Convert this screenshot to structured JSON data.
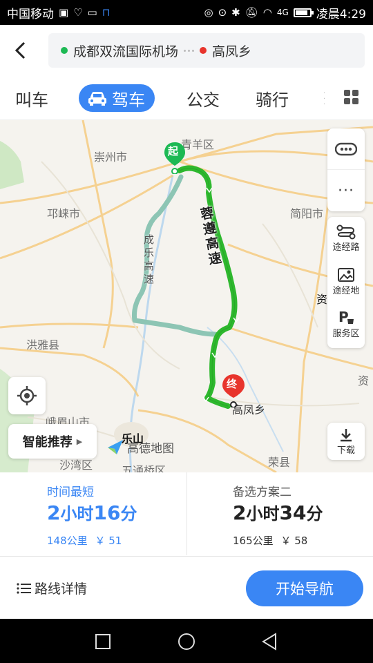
{
  "status": {
    "carrier": "中国移动",
    "network": "4G",
    "time": "凌晨4:29",
    "battery_level": 0.85
  },
  "route": {
    "origin": "成都双流国际机场",
    "destination": "高凤乡",
    "origin_color": "#1db954",
    "destination_color": "#e8342c"
  },
  "modes": [
    {
      "label": "叫车"
    },
    {
      "label": "驾车"
    },
    {
      "label": "公交"
    },
    {
      "label": "骑行"
    }
  ],
  "map": {
    "places": {
      "qingyang": "青羊区",
      "chongzhou": "崇州市",
      "qionglai": "邛崃市",
      "jianyang": "简阳市",
      "hongya": "洪雅县",
      "emeishan": "峨眉山市",
      "leshan": "乐山",
      "shawan": "沙湾区",
      "wutongqiao": "五通桥区",
      "rongxian": "荣县",
      "zi1": "资",
      "zi2": "资",
      "gaofeng": "高凤乡"
    },
    "highways": {
      "rongzun": "蓉遵高速",
      "chengle": "成乐高速"
    },
    "start_label": "起",
    "end_label": "终",
    "brand": "高德地图",
    "route_color": "#2eb82e",
    "alt_route_color": "#8dc5b4"
  },
  "side_tools": [
    {
      "label": "途经路"
    },
    {
      "label": "途经地"
    },
    {
      "label": "服务区"
    }
  ],
  "download_label": "下载",
  "smart_recommend_label": "智能推荐",
  "plans": [
    {
      "tag": "时间最短",
      "duration_num1": "2",
      "duration_unit1": "小时",
      "duration_num2": "16",
      "duration_unit2": "分",
      "distance": "148公里",
      "cost": "￥ 51"
    },
    {
      "tag": "备选方案二",
      "duration_num1": "2",
      "duration_unit1": "小时",
      "duration_num2": "34",
      "duration_unit2": "分",
      "distance": "165公里",
      "cost": "￥ 58"
    }
  ],
  "route_detail_label": "路线详情",
  "start_nav_label": "开始导航",
  "accent_color": "#3a86f4"
}
